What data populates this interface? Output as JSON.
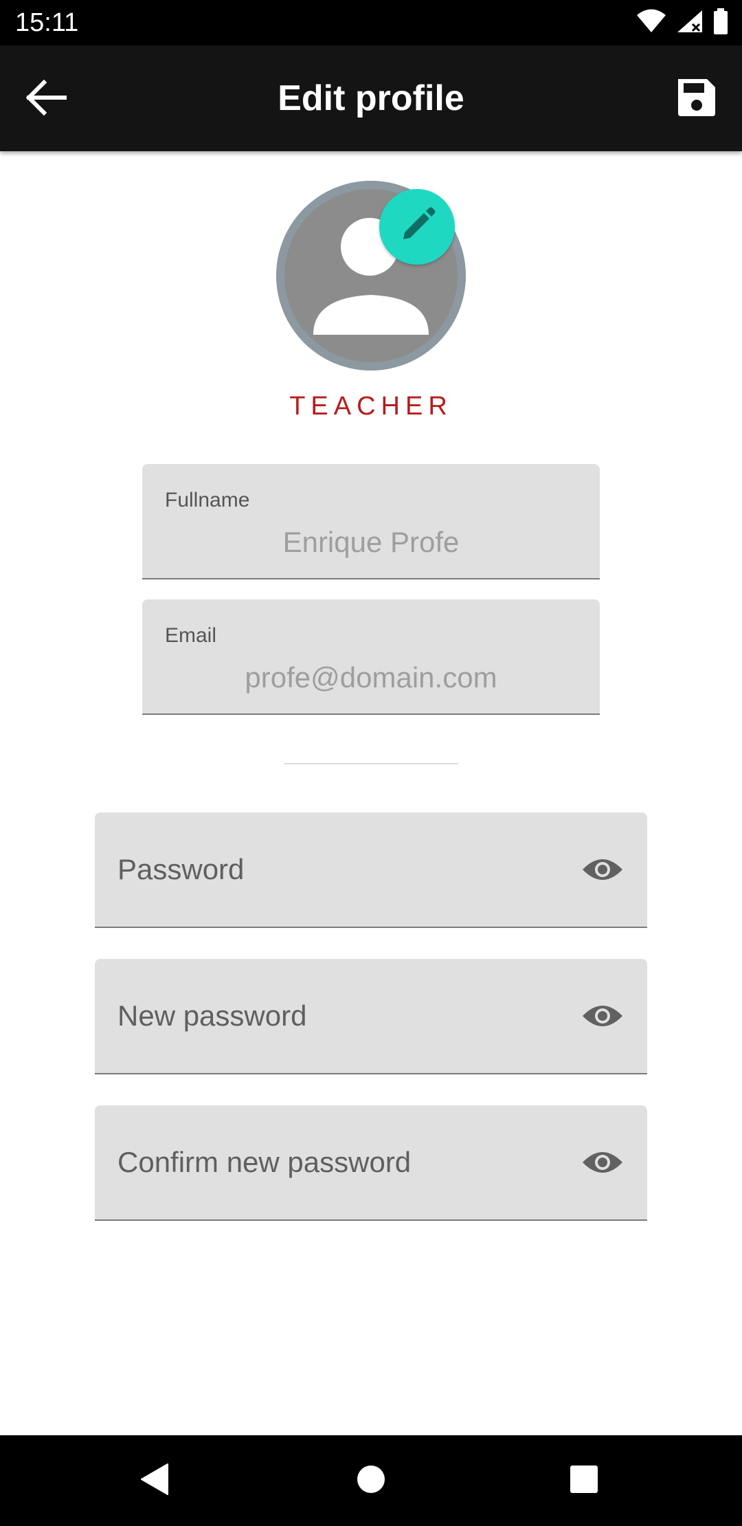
{
  "status_bar": {
    "time": "15:11",
    "icons": [
      "wifi-icon",
      "signal-icon",
      "battery-icon"
    ]
  },
  "app_bar": {
    "title": "Edit profile",
    "back_icon": "arrow-back-icon",
    "save_icon": "save-icon"
  },
  "profile": {
    "role": "TEACHER",
    "edit_icon": "pencil-icon"
  },
  "fields": {
    "fullname": {
      "label": "Fullname",
      "value": "Enrique Profe"
    },
    "email": {
      "label": "Email",
      "value": "profe@domain.com"
    }
  },
  "password_fields": [
    {
      "label": "Password",
      "icon": "eye-icon"
    },
    {
      "label": "New password",
      "icon": "eye-icon"
    },
    {
      "label": "Confirm new password",
      "icon": "eye-icon"
    }
  ],
  "colors": {
    "app_bar": "#141414",
    "role": "#b71c1c",
    "accent": "#1fd8c2",
    "field_bg": "#e0e0e0"
  },
  "nav_bar": {
    "buttons": [
      "back-triangle-icon",
      "home-circle-icon",
      "recents-square-icon"
    ]
  }
}
